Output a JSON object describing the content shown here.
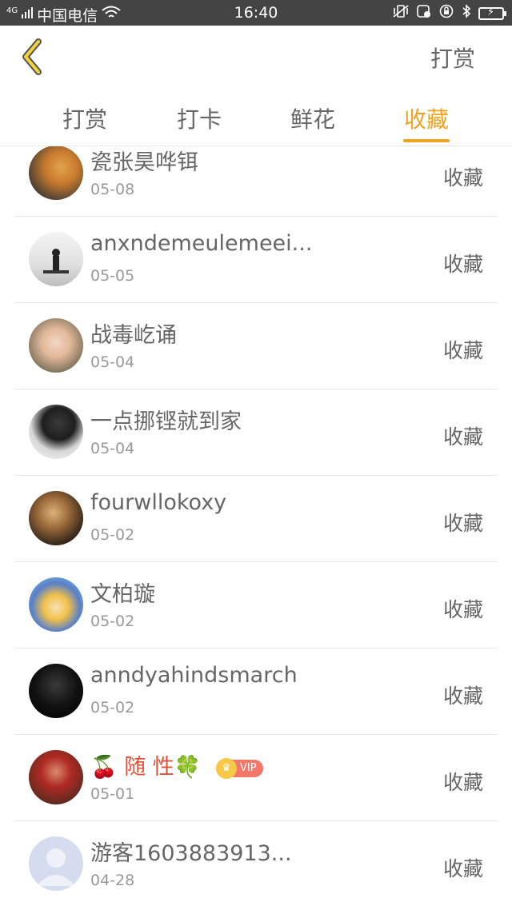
{
  "status_bar": {
    "network_tag": "4G",
    "carrier": "中国电信",
    "time": "16:40"
  },
  "header": {
    "back_icon": "chevron-left-icon",
    "right_label": "打赏"
  },
  "tabs": [
    {
      "label": "打赏",
      "active": false
    },
    {
      "label": "打卡",
      "active": false
    },
    {
      "label": "鲜花",
      "active": false
    },
    {
      "label": "收藏",
      "active": true
    }
  ],
  "accent_color": "#f0a31e",
  "list": [
    {
      "name": "瓷张昊哗铒",
      "date": "05-08",
      "action": "收藏"
    },
    {
      "name": "anxndemeulemeei...",
      "date": "05-05",
      "action": "收藏"
    },
    {
      "name": "战毒屹诵",
      "date": "05-04",
      "action": "收藏"
    },
    {
      "name": "一点挪铿就到家",
      "date": "05-04",
      "action": "收藏"
    },
    {
      "name": "fourwllokoxy",
      "date": "05-02",
      "action": "收藏"
    },
    {
      "name": "文柏璇",
      "date": "05-02",
      "action": "收藏"
    },
    {
      "name": "anndyahindsmarch",
      "date": "05-02",
      "action": "收藏"
    },
    {
      "name": "🍒 随 性🍀",
      "badge": "VIP",
      "date": "05-01",
      "action": "收藏"
    },
    {
      "name": "游客1603883913...",
      "date": "04-28",
      "action": "收藏"
    }
  ]
}
